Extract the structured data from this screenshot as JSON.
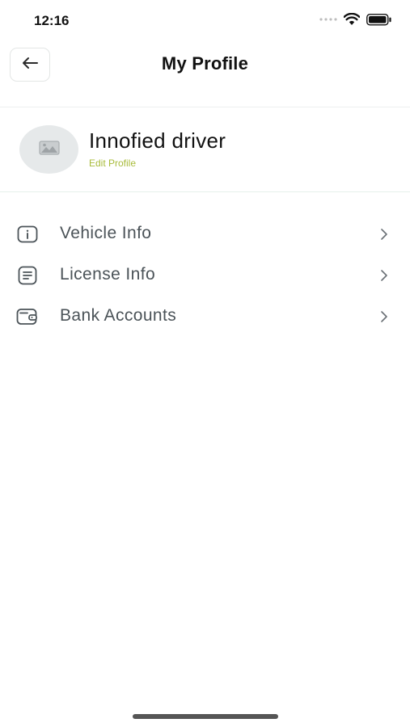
{
  "status_bar": {
    "time": "12:16"
  },
  "header": {
    "title": "My Profile",
    "back_icon": "arrow-left-icon"
  },
  "profile": {
    "name": "Innofied driver",
    "edit_label": "Edit Profile",
    "avatar_icon": "image-placeholder-icon"
  },
  "menu": {
    "items": [
      {
        "label": "Vehicle Info",
        "icon": "info-icon"
      },
      {
        "label": "License Info",
        "icon": "document-icon"
      },
      {
        "label": "Bank Accounts",
        "icon": "wallet-icon"
      }
    ]
  },
  "colors": {
    "accent_green": "#a8bb3a",
    "menu_text": "#4b5358",
    "avatar_bg": "#e6e9ea"
  }
}
